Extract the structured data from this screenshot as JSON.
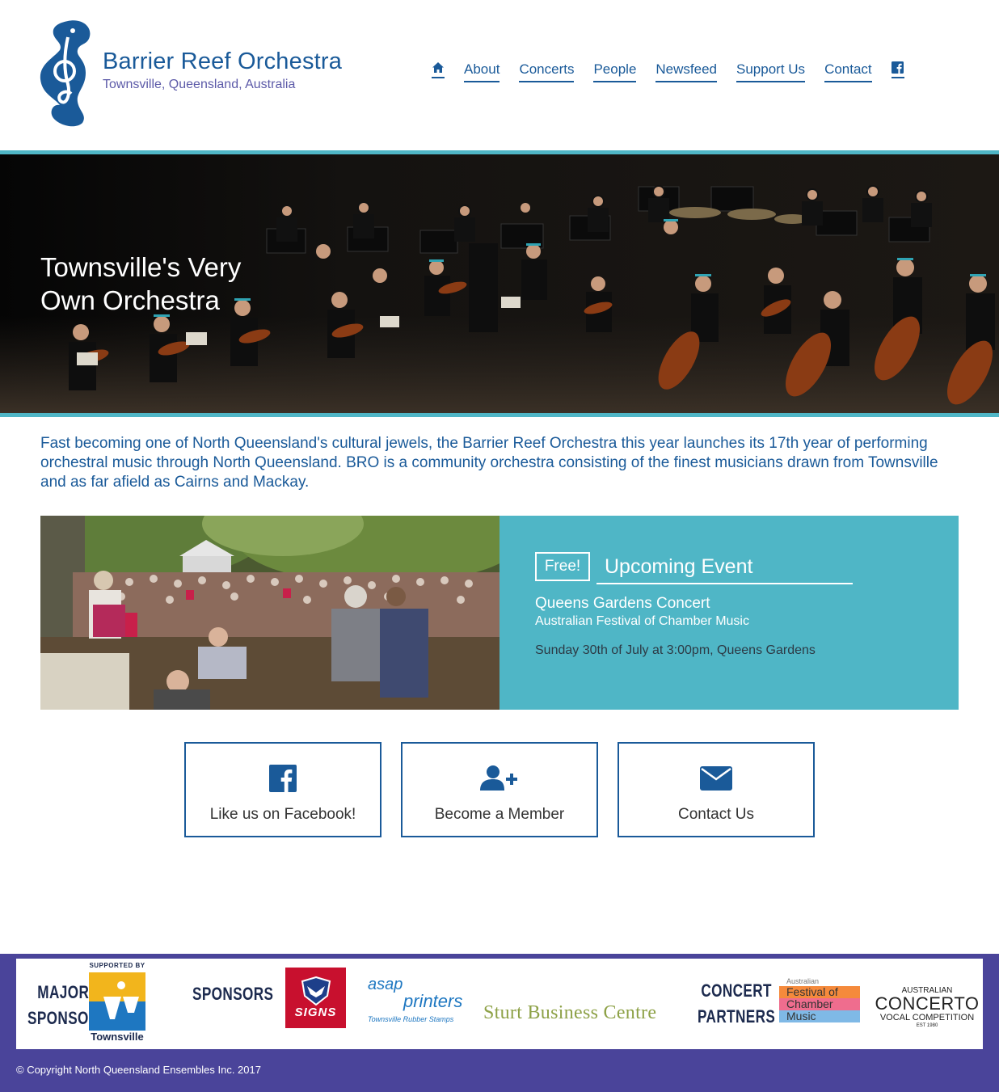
{
  "brand": {
    "title": "Barrier Reef Orchestra",
    "subtitle": "Townsville, Queensland, Australia"
  },
  "nav": {
    "home_icon": "home-icon",
    "items": [
      {
        "label": "About"
      },
      {
        "label": "Concerts"
      },
      {
        "label": "People"
      },
      {
        "label": "Newsfeed"
      },
      {
        "label": "Support Us"
      },
      {
        "label": "Contact"
      }
    ],
    "social_icon": "facebook-icon"
  },
  "hero": {
    "title": "Townsville's Very Own Orchestra"
  },
  "intro": {
    "text": "Fast becoming one of North Queensland's cultural jewels, the Barrier Reef Orchestra this year launches its 17th year of performing orchestral music through North Queensland. BRO is a community orchestra consisting of the finest musicians drawn from Townsville and as far afield as Cairns and Mackay."
  },
  "event": {
    "badge": "Free!",
    "heading": "Upcoming Event",
    "name": "Queens Gardens Concert",
    "subtitle": "Australian Festival of Chamber Music",
    "datetime": "Sunday 30th of July at 3:00pm, Queens Gardens"
  },
  "actions": [
    {
      "label": "Like us on Facebook!",
      "icon": "facebook-icon"
    },
    {
      "label": "Become a Member",
      "icon": "user-plus-icon"
    },
    {
      "label": "Contact Us",
      "icon": "envelope-icon"
    }
  ],
  "sponsors": {
    "major_label_1": "MAJOR",
    "major_label_2": "SPONSOR",
    "supported_by": "SUPPORTED BY",
    "townsville": "Townsville",
    "sponsors_label": "SPONSORS",
    "signs": "SIGNS",
    "asap_1": "asap",
    "asap_2": "printers",
    "asap_3": "Townsville Rubber Stamps",
    "sturt": "Sturt Business Centre",
    "partners_label_1": "CONCERT",
    "partners_label_2": "PARTNERS",
    "festival_1": "Australian",
    "festival_2": "Festival of",
    "festival_3": "Chamber",
    "festival_4": "Music",
    "concerto_1": "AUSTRALIAN",
    "concerto_2": "CONCERTO",
    "concerto_3": "VOCAL COMPETITION",
    "concerto_4": "EST 1980"
  },
  "footer": {
    "copyright": "© Copyright North Queensland Ensembles Inc. 2017"
  },
  "colors": {
    "brand_blue": "#1a5a99",
    "teal": "#4fb6c6",
    "footer_purple": "#4a449a"
  }
}
